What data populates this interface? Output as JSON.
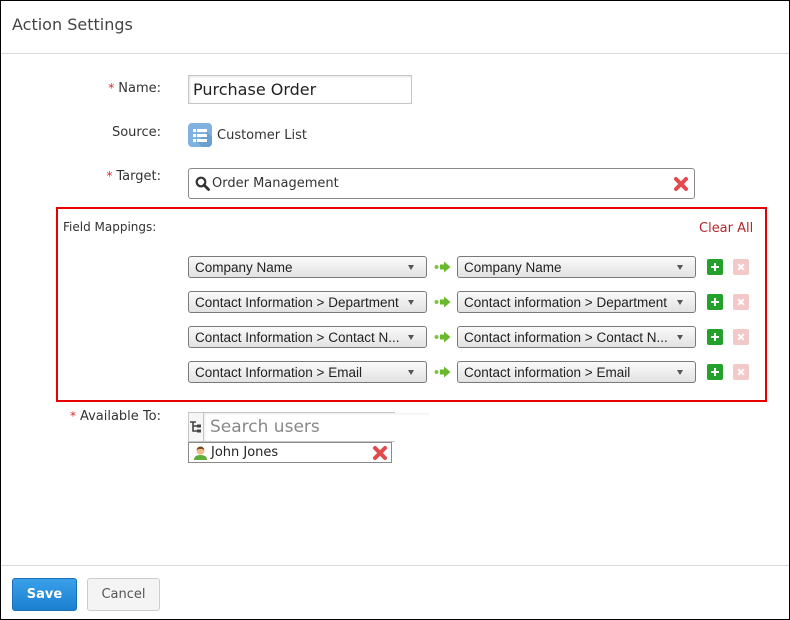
{
  "header": {
    "title": "Action Settings"
  },
  "form": {
    "name": {
      "label": "Name:",
      "required": true,
      "value": "Purchase Order"
    },
    "source": {
      "label": "Source:",
      "icon": "table-list-icon",
      "value": "Customer List"
    },
    "target": {
      "label": "Target:",
      "required": true,
      "icon": "search-icon",
      "value": "Order Management",
      "clear_icon": "red-x-icon"
    },
    "field_mappings": {
      "label": "Field Mappings:",
      "clear_all_label": "Clear All",
      "rows": [
        {
          "source": "Company Name",
          "target": "Company Name"
        },
        {
          "source": "Contact Information > Department",
          "target": "Contact information > Department"
        },
        {
          "source": "Contact Information > Contact N...",
          "target": "Contact information > Contact N..."
        },
        {
          "source": "Contact Information > Email",
          "target": "Contact information > Email"
        }
      ]
    },
    "available_to": {
      "label": "Available To:",
      "required": true,
      "search_placeholder": "Search users",
      "users": [
        {
          "name": "John Jones",
          "icon": "user-avatar-icon"
        }
      ]
    }
  },
  "footer": {
    "save_label": "Save",
    "cancel_label": "Cancel"
  },
  "colors": {
    "required": "#e0262a",
    "highlight_border": "#e60000",
    "clear_all": "#b02a2a",
    "save": "#1b7fcf",
    "add": "#23a12a",
    "delete_disabled": "#f2c8c8"
  }
}
